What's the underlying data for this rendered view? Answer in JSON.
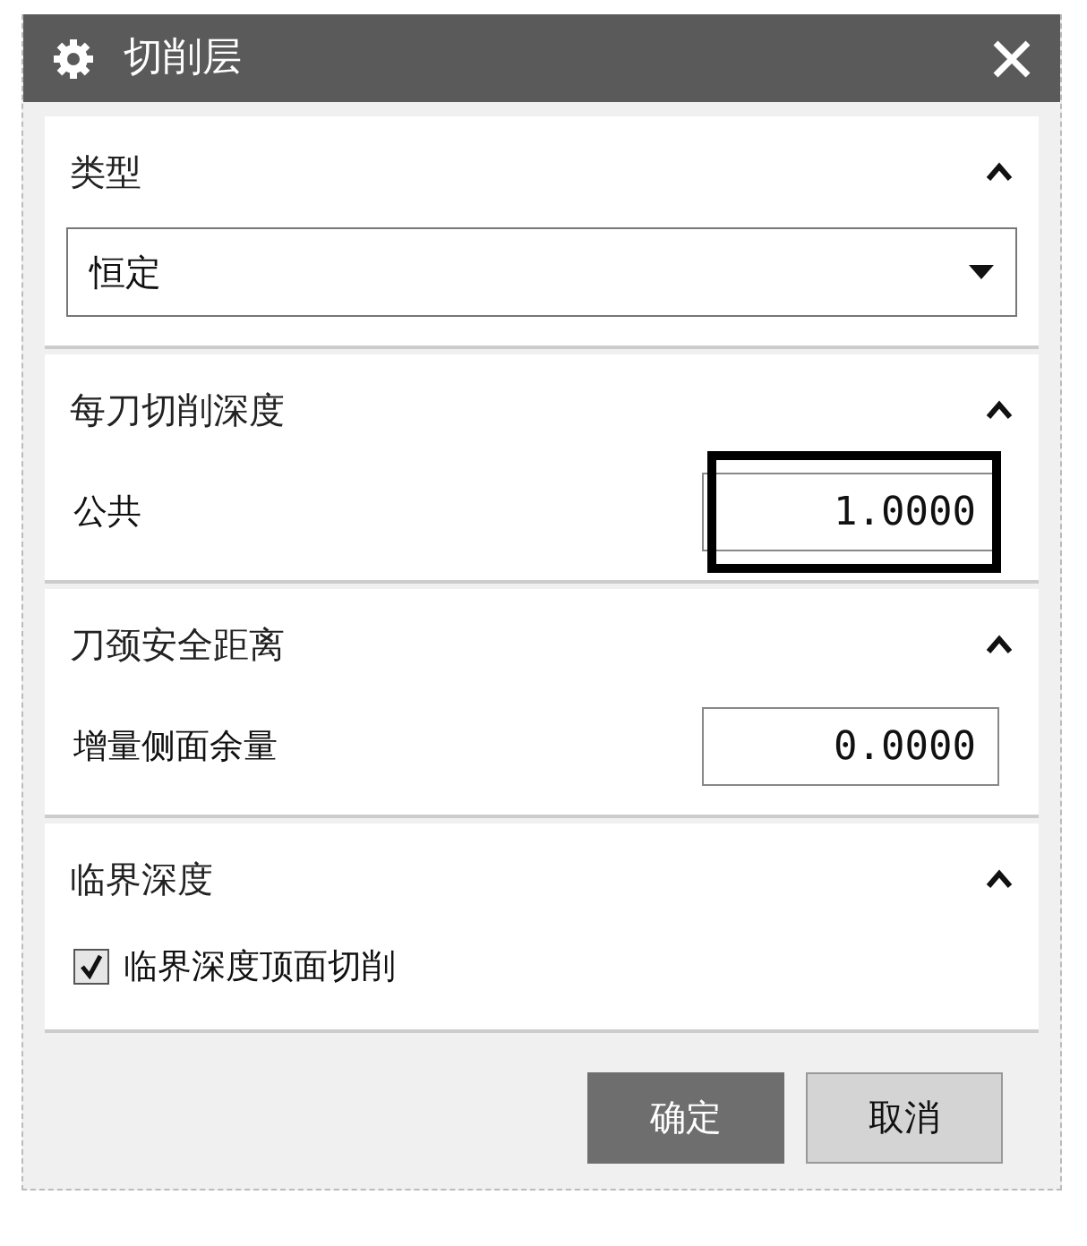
{
  "window": {
    "title": "切削层"
  },
  "sections": [
    {
      "title": "类型",
      "expanded": true,
      "rows": [
        {
          "kind": "select",
          "value": "恒定"
        }
      ]
    },
    {
      "title": "每刀切削深度",
      "expanded": true,
      "rows": [
        {
          "kind": "number",
          "label": "公共",
          "value": "1.0000",
          "highlighted": true
        }
      ]
    },
    {
      "title": "刀颈安全距离",
      "expanded": true,
      "rows": [
        {
          "kind": "number",
          "label": "增量侧面余量",
          "value": "0.0000",
          "highlighted": false
        }
      ]
    },
    {
      "title": "临界深度",
      "expanded": true,
      "rows": [
        {
          "kind": "checkbox",
          "label": "临界深度顶面切削",
          "checked": true
        }
      ]
    }
  ],
  "buttons": [
    {
      "label": "确定",
      "primary": true
    },
    {
      "label": "取消",
      "primary": false
    }
  ]
}
